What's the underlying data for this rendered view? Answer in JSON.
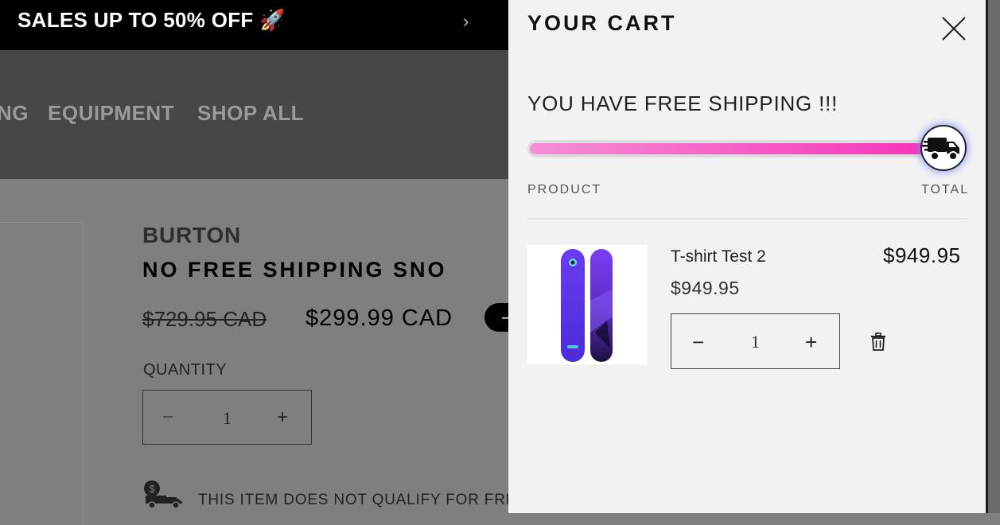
{
  "announcement": {
    "text": "SALES UP TO 50% OFF 🚀",
    "arrow": "›"
  },
  "nav": {
    "items": [
      "NG",
      "EQUIPMENT",
      "SHOP ALL"
    ]
  },
  "product": {
    "brand": "BURTON",
    "title": "NO FREE SHIPPING SNO",
    "compare_price": "$729.95 CAD",
    "price": "$299.99 CAD",
    "sale_badge": "–",
    "quantity_label": "QUANTITY",
    "quantity": "1",
    "minus": "−",
    "plus": "+",
    "shipping_note": "THIS ITEM DOES NOT QUALIFY FOR FREE"
  },
  "cart": {
    "title": "YOUR CART",
    "free_shipping_message": "YOU HAVE FREE SHIPPING !!!",
    "free_shipping_progress": 1.0,
    "col_product": "PRODUCT",
    "col_total": "TOTAL",
    "items": [
      {
        "name": "T-shirt Test 2",
        "price": "$949.95",
        "total": "$949.95",
        "quantity": "1"
      }
    ],
    "minus": "−",
    "plus": "+"
  },
  "icons": {
    "close": "close-icon",
    "truck": "delivery-truck-icon",
    "trash": "trash-icon",
    "money_truck": "shipping-money-truck-icon"
  },
  "colors": {
    "progress_start": "#f58fd5",
    "progress_end": "#f52fb8",
    "overlay": "#808080",
    "drawer": "#f2f2f2"
  }
}
